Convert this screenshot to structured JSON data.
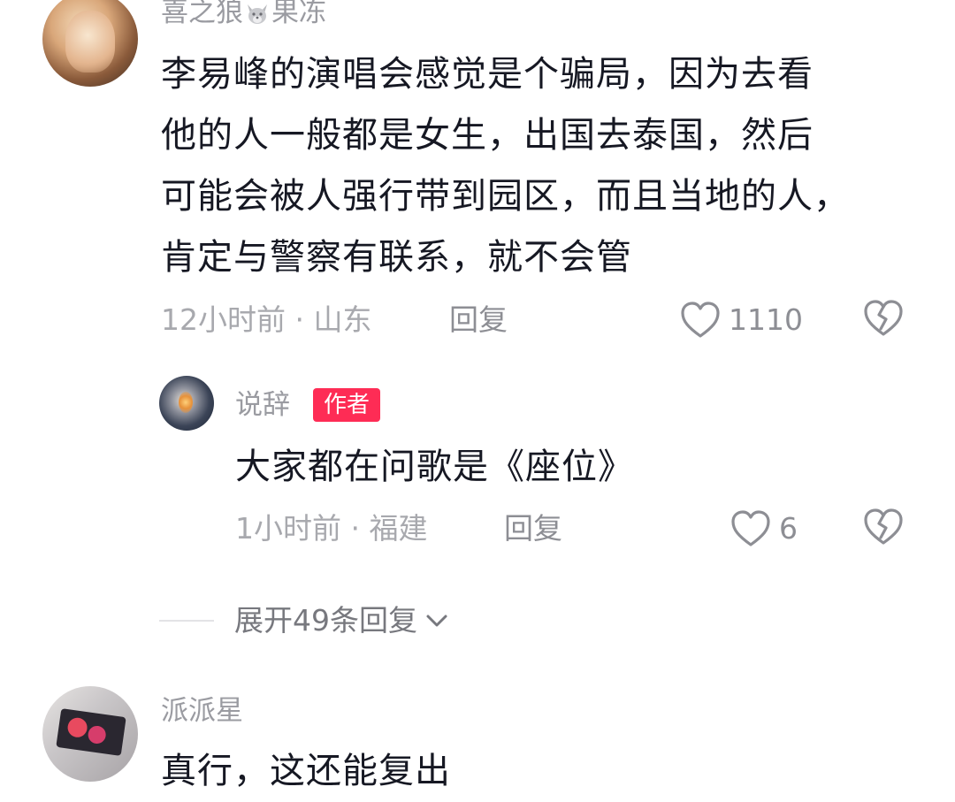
{
  "comments": [
    {
      "username_part1": "喜之狼",
      "username_icon": "wolf-emoji-icon",
      "username_part2": "果冻",
      "text_lines": [
        "李易峰的演唱会感觉是个骗局，因为去看",
        "他的人一般都是女生，出国去泰国，然后",
        "可能会被人强行带到园区，而且当地的人，",
        "肯定与警察有联系，就不会管"
      ],
      "meta": "12小时前 · 山东",
      "reply_label": "回复",
      "like_count": "1110"
    },
    {
      "username": "说辞",
      "badge": "作者",
      "text": "大家都在问歌是《座位》",
      "meta": "1小时前 · 福建",
      "reply_label": "回复",
      "like_count": "6"
    },
    {
      "username": "派派星",
      "text_partial": "真行，这还能复出"
    }
  ],
  "expand_replies": "展开49条回复",
  "colors": {
    "author_badge": "#fe2c55",
    "muted_text": "#a8a9ae",
    "main_text": "#161823"
  }
}
